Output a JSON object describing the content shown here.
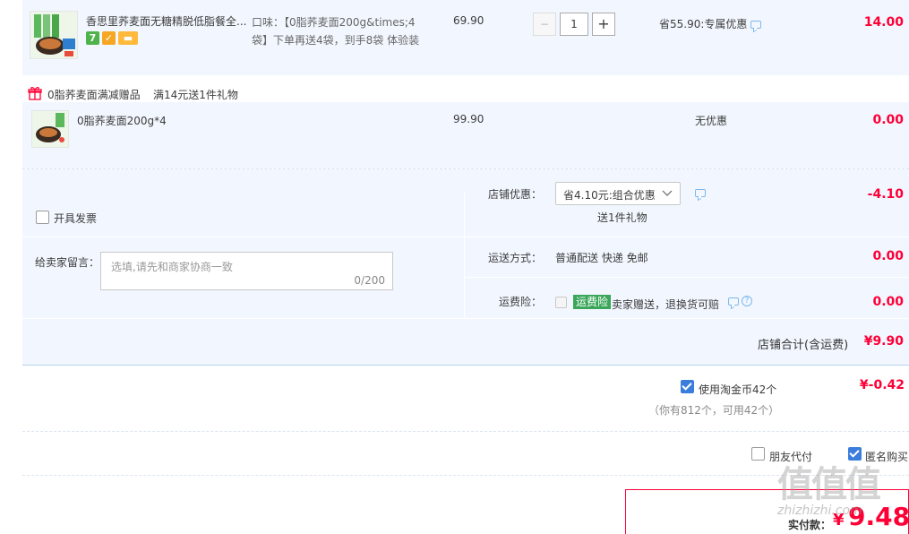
{
  "item1": {
    "title": "香思里荞麦面无糖精脱低脂餐全...",
    "sku": "口味：【0脂荞麦面200g&times;4袋】下单再送4袋，到手8袋 体验装",
    "price": "69.90",
    "quantity": "1",
    "minus": "−",
    "plus": "+",
    "promo": "省55.90:专属优惠",
    "subtotal": "14.00",
    "badge_seven": "7"
  },
  "gift_header": {
    "label": "0脂荞麦面满减赠品",
    "rule": "满14元送1件礼物"
  },
  "item2": {
    "title": "0脂荞麦面200g*4",
    "price": "99.90",
    "promo": "无优惠",
    "subtotal": "0.00"
  },
  "invoice": {
    "label": "开具发票"
  },
  "message": {
    "label": "给卖家留言：",
    "placeholder": "选填,请先和商家协商一致",
    "counter": "0/200"
  },
  "shop_discount": {
    "label": "店铺优惠：",
    "selected": "省4.10元:组合优惠",
    "note": "送1件礼物",
    "amount": "-4.10"
  },
  "shipping": {
    "label": "运送方式：",
    "value": "普通配送 快递 免邮",
    "amount": "0.00"
  },
  "insurance": {
    "label": "运费险：",
    "tag": "运费险",
    "text": "卖家赠送，退换货可赔",
    "amount": "0.00"
  },
  "shop_total": {
    "label": "店铺合计(含运费)",
    "amount": "¥9.90"
  },
  "coins": {
    "label": "使用淘金币42个",
    "amount": "¥-0.42",
    "note": "（你有812个，可用42个）"
  },
  "options": {
    "friend_pay": "朋友代付",
    "anonymous": "匿名购买"
  },
  "final": {
    "label": "实付款：",
    "currency": "¥",
    "amount": "9.48"
  },
  "watermark": {
    "logo": "值值值",
    "url": "zhizhizhi.com"
  },
  "colors": {
    "accent_red": "#ff0036",
    "panel_blue": "#f2f7ff",
    "checkbox_blue": "#3b7ddd",
    "tag_green": "#3aa659"
  }
}
